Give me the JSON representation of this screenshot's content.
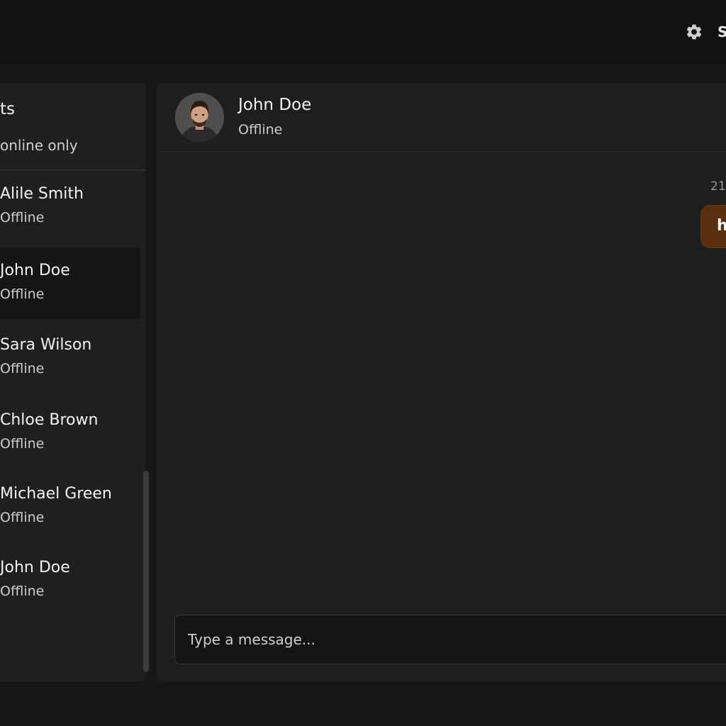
{
  "topbar": {
    "settings_icon": "gear-icon",
    "label": "S"
  },
  "sidebar": {
    "title": "ts",
    "filter_label": "online only",
    "contacts": [
      {
        "name": "Alile Smith",
        "status": "Offline"
      },
      {
        "name": "John Doe",
        "status": "Offline",
        "active": true
      },
      {
        "name": "Sara Wilson",
        "status": "Offline"
      },
      {
        "name": "Chloe Brown",
        "status": "Offline"
      },
      {
        "name": "Michael Green",
        "status": "Offline"
      },
      {
        "name": "John Doe",
        "status": "Offline"
      }
    ]
  },
  "chat": {
    "contact_name": "John Doe",
    "contact_status": "Offline",
    "messages": [
      {
        "time": "21",
        "text": "h",
        "direction": "outgoing"
      }
    ],
    "composer": {
      "placeholder": "Type a message...",
      "value": ""
    }
  },
  "colors": {
    "background": "#171717",
    "panel": "#1e1e1e",
    "outgoing_bubble": "#5a2f0e"
  }
}
